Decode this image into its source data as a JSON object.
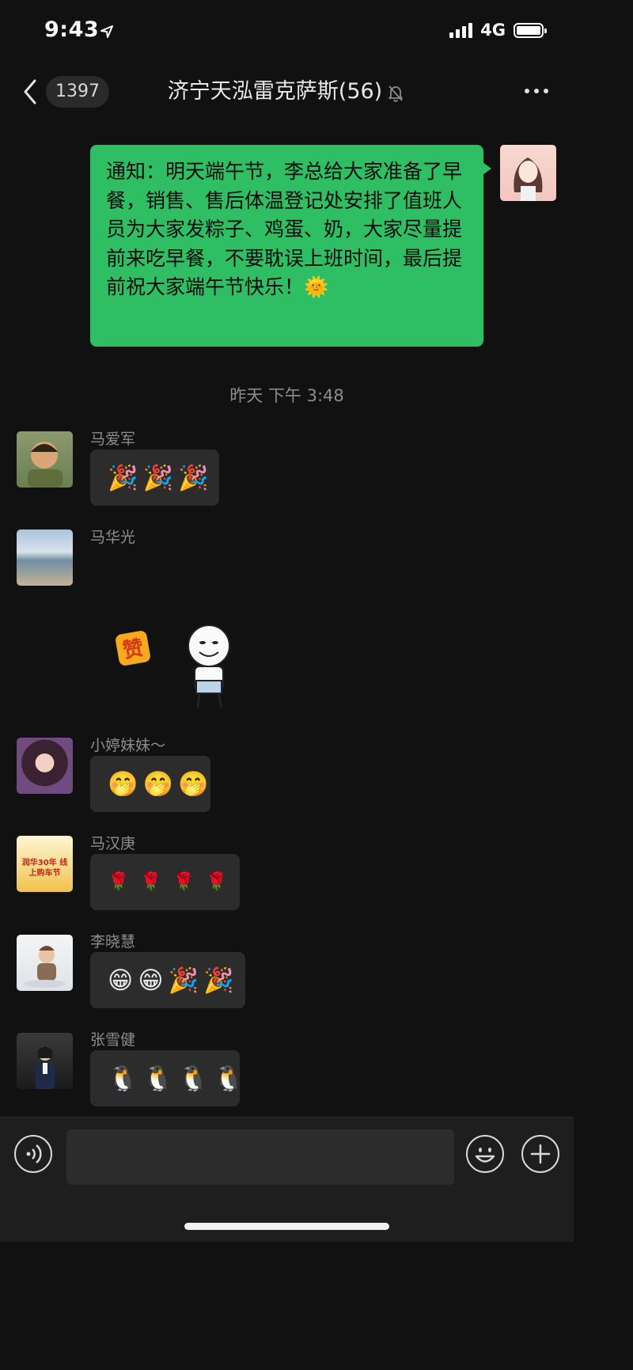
{
  "status_bar": {
    "time": "9:43",
    "network": "4G",
    "battery_level": 0.9
  },
  "nav": {
    "unread_count": "1397",
    "title": "济宁天泓雷克萨斯(56)"
  },
  "messages": {
    "self": {
      "text": "通知：明天端午节，李总给大家准备了早餐，销售、售后体温登记处安排了值班人员为大家发粽子、鸡蛋、奶，大家尽量提前来吃早餐，不要耽误上班时间，最后提前祝大家端午节快乐！🌞"
    },
    "divider": "昨天 下午 3:48",
    "m1": {
      "sender": "马爱军",
      "emoji": [
        "🎉",
        "🎉",
        "🎉"
      ]
    },
    "m2": {
      "sender": "马华光",
      "sticker_text": "赞"
    },
    "m3": {
      "sender": "小婷妹妹～",
      "emoji": [
        "🤭",
        "🤭",
        "🤭"
      ]
    },
    "m4": {
      "sender": "马汉庚",
      "emoji": [
        "🌹",
        "🌹",
        "🌹",
        "🌹"
      ],
      "avatar_text": "润华30年 线上购车节"
    },
    "m5": {
      "sender": "李晓慧",
      "emoji": [
        "😁",
        "😁",
        "🎉",
        "🎉"
      ]
    },
    "m6": {
      "sender": "张雪健",
      "emoji": [
        "🐧",
        "🐧",
        "🐧",
        "🐧"
      ]
    }
  },
  "icons": {
    "back": "chevron-left-icon",
    "mute": "bell-slash-icon",
    "more": "more-dots-icon",
    "voice": "voice-icon",
    "emoji": "smiley-icon",
    "plus": "plus-icon"
  },
  "colors": {
    "background": "#111111",
    "self_bubble": "#2fbe63",
    "other_bubble": "#2c2c2c",
    "name_text": "#8d8d8d"
  }
}
